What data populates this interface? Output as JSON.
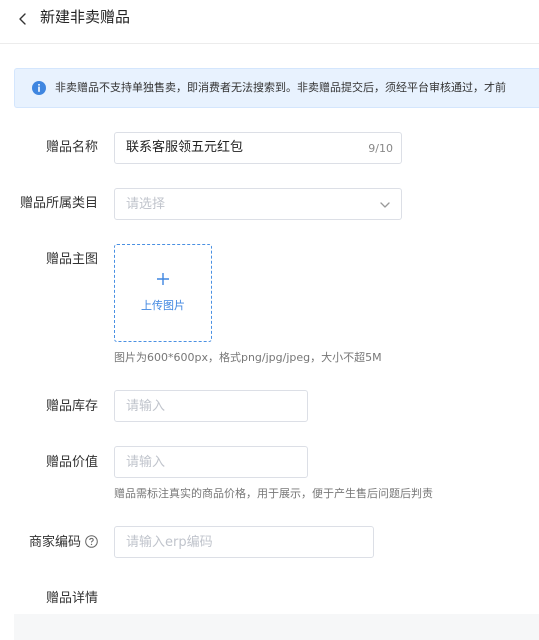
{
  "header": {
    "title": "新建非卖赠品",
    "back_icon": "chevron-left-icon"
  },
  "notice": {
    "icon": "info-circle-icon",
    "color": "#3f86e0",
    "text": "非卖赠品不支持单独售卖，即消费者无法搜索到。非卖赠品提交后，须经平台审核通过，才前"
  },
  "form": {
    "name": {
      "label": "赠品名称",
      "value": "联系客服领五元红包",
      "counter": "9/10"
    },
    "category": {
      "label": "赠品所属类目",
      "placeholder": "请选择"
    },
    "main_image": {
      "label": "赠品主图",
      "upload_label": "上传图片",
      "hint": "图片为600*600px，格式png/jpg/jpeg，大小不超5M"
    },
    "stock": {
      "label": "赠品库存",
      "placeholder": "请输入"
    },
    "value": {
      "label": "赠品价值",
      "placeholder": "请输入",
      "hint": "赠品需标注真实的商品价格，用于展示，便于产生售后问题后判责"
    },
    "merchant_code": {
      "label": "商家编码",
      "placeholder": "请输入erp编码",
      "help_icon": "question-circle-icon"
    },
    "details": {
      "label": "赠品详情"
    }
  },
  "colors": {
    "accent": "#3f86e0",
    "notice_bg": "#e8f2fe",
    "border": "#dcdfe6",
    "placeholder": "#c0c4cc"
  }
}
